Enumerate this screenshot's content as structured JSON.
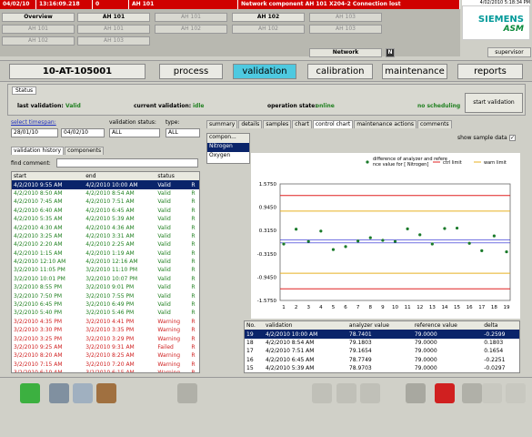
{
  "alarm": {
    "date": "04/02/10",
    "time": "13:16:09.218",
    "num": "0",
    "area": "AH 101",
    "message": "Network component AH 101 X204-2  Connection lost"
  },
  "grid": {
    "overview": "Overview",
    "ah101": "AH 101",
    "ah102": "AH 102",
    "network": "Network",
    "n_badge": "N",
    "dim1": "AH 101",
    "dim2": "AH 102",
    "dim3": "AH 103"
  },
  "logo": {
    "brand": "SIEMENS",
    "sub": "ASM",
    "datetime": "4/02/2010 5:18:34 PM"
  },
  "user": "supervisor",
  "tag": "10-AT-105001",
  "nav": [
    "process",
    "validation",
    "calibration",
    "maintenance",
    "reports"
  ],
  "status": {
    "tab": "Status",
    "last_label": "last validation:",
    "last_value": "Valid",
    "cur_label": "current validation:",
    "cur_value": "idle",
    "op_label": "operation state:",
    "op_value": "online",
    "sched": "no scheduling",
    "start_btn": "start validation"
  },
  "filters": {
    "timespan_label": "select timespan:",
    "from": "28/01/10",
    "to": "04/02/10",
    "vstatus_label": "validation status:",
    "vstatus": "ALL",
    "type_label": "type:",
    "type": "ALL"
  },
  "lefttabs": [
    "validation history",
    "components"
  ],
  "find_label": "find comment:",
  "hist_headers": [
    "start",
    "end",
    "status",
    ""
  ],
  "history": [
    {
      "s": "4/2/2010 9:55 AM",
      "e": "4/2/2010 10:00 AM",
      "st": "Valid",
      "t": "R",
      "c": "sel"
    },
    {
      "s": "4/2/2010 8:50 AM",
      "e": "4/2/2010 8:54 AM",
      "st": "Valid",
      "t": "R",
      "c": "green"
    },
    {
      "s": "4/2/2010 7:45 AM",
      "e": "4/2/2010 7:51 AM",
      "st": "Valid",
      "t": "R",
      "c": "green"
    },
    {
      "s": "4/2/2010 6:40 AM",
      "e": "4/2/2010 6:45 AM",
      "st": "Valid",
      "t": "R",
      "c": "green"
    },
    {
      "s": "4/2/2010 5:35 AM",
      "e": "4/2/2010 5:39 AM",
      "st": "Valid",
      "t": "R",
      "c": "green"
    },
    {
      "s": "4/2/2010 4:30 AM",
      "e": "4/2/2010 4:36 AM",
      "st": "Valid",
      "t": "R",
      "c": "green"
    },
    {
      "s": "4/2/2010 3:25 AM",
      "e": "4/2/2010 3:31 AM",
      "st": "Valid",
      "t": "R",
      "c": "green"
    },
    {
      "s": "4/2/2010 2:20 AM",
      "e": "4/2/2010 2:25 AM",
      "st": "Valid",
      "t": "R",
      "c": "green"
    },
    {
      "s": "4/2/2010 1:15 AM",
      "e": "4/2/2010 1:19 AM",
      "st": "Valid",
      "t": "R",
      "c": "green"
    },
    {
      "s": "4/2/2010 12:10 AM",
      "e": "4/2/2010 12:16 AM",
      "st": "Valid",
      "t": "R",
      "c": "green"
    },
    {
      "s": "3/2/2010 11:05 PM",
      "e": "3/2/2010 11:10 PM",
      "st": "Valid",
      "t": "R",
      "c": "green"
    },
    {
      "s": "3/2/2010 10:01 PM",
      "e": "3/2/2010 10:07 PM",
      "st": "Valid",
      "t": "R",
      "c": "green"
    },
    {
      "s": "3/2/2010 8:55 PM",
      "e": "3/2/2010 9:01 PM",
      "st": "Valid",
      "t": "R",
      "c": "green"
    },
    {
      "s": "3/2/2010 7:50 PM",
      "e": "3/2/2010 7:55 PM",
      "st": "Valid",
      "t": "R",
      "c": "green"
    },
    {
      "s": "3/2/2010 6:45 PM",
      "e": "3/2/2010 6:49 PM",
      "st": "Valid",
      "t": "R",
      "c": "green"
    },
    {
      "s": "3/2/2010 5:40 PM",
      "e": "3/2/2010 5:46 PM",
      "st": "Valid",
      "t": "R",
      "c": "green"
    },
    {
      "s": "3/2/2010 4:35 PM",
      "e": "3/2/2010 4:41 PM",
      "st": "Warning",
      "t": "R",
      "c": "red"
    },
    {
      "s": "3/2/2010 3:30 PM",
      "e": "3/2/2010 3:35 PM",
      "st": "Warning",
      "t": "R",
      "c": "red"
    },
    {
      "s": "3/2/2010 3:25 PM",
      "e": "3/2/2010 3:29 PM",
      "st": "Warning",
      "t": "R",
      "c": "red"
    },
    {
      "s": "3/2/2010 9:25 AM",
      "e": "3/2/2010 9:31 AM",
      "st": "Failed",
      "t": "R",
      "c": "red"
    },
    {
      "s": "3/2/2010 8:20 AM",
      "e": "3/2/2010 8:25 AM",
      "st": "Warning",
      "t": "R",
      "c": "red"
    },
    {
      "s": "3/2/2010 7:15 AM",
      "e": "3/2/2010 7:20 AM",
      "st": "Warning",
      "t": "R",
      "c": "red"
    },
    {
      "s": "3/2/2010 6:10 AM",
      "e": "3/2/2010 6:15 AM",
      "st": "Warning",
      "t": "R",
      "c": "red"
    }
  ],
  "righttabs": [
    "summary",
    "details",
    "samples",
    "chart",
    "control chart",
    "maintenance actions",
    "comments"
  ],
  "components_header": "compon...",
  "components": [
    "Nitrogen",
    "Oxygen"
  ],
  "show_sample": "show sample data",
  "table_headers": [
    "No.",
    "validation",
    "analyzer value",
    "reference value",
    "delta"
  ],
  "table_rows": [
    {
      "no": "19",
      "v": "4/2/2010 10:00 AM",
      "a": "78.7401",
      "r": "79.0000",
      "d": "-0.2599"
    },
    {
      "no": "18",
      "v": "4/2/2010 8:54 AM",
      "a": "79.1803",
      "r": "79.0000",
      "d": "0.1803"
    },
    {
      "no": "17",
      "v": "4/2/2010 7:51 AM",
      "a": "79.1654",
      "r": "79.0000",
      "d": "0.1654"
    },
    {
      "no": "16",
      "v": "4/2/2010 6:45 AM",
      "a": "78.7749",
      "r": "79.0000",
      "d": "-0.2251"
    },
    {
      "no": "15",
      "v": "4/2/2010 5:39 AM",
      "a": "78.9703",
      "r": "79.0000",
      "d": "-0.0297"
    },
    {
      "no": "14",
      "v": "4/2/2010 4:36 AM",
      "a": "79.3805",
      "r": "79.0000",
      "d": "0.3805"
    },
    {
      "no": "13",
      "v": "4/2/2010 3:31 AM",
      "a": "79.3780",
      "r": "79.0000",
      "d": "0.3780"
    }
  ],
  "chart_data": {
    "type": "scatter",
    "legend": [
      "difference of analyzer and reference value for [ Nitrogen]",
      "ctrl limit",
      "warn limit"
    ],
    "yticks": [
      "1.5750",
      "0.9450",
      "0.3150",
      "-0.3150",
      "-0.9450",
      "-1.5750"
    ],
    "ylim": [
      -1.575,
      1.575
    ],
    "x": [
      1,
      2,
      3,
      4,
      5,
      6,
      7,
      8,
      9,
      10,
      11,
      12,
      13,
      14,
      15,
      16,
      17,
      18,
      19
    ],
    "y": [
      -0.05,
      0.35,
      0.02,
      0.3,
      -0.2,
      -0.12,
      0.03,
      0.12,
      0.05,
      0.02,
      0.36,
      0.2,
      -0.05,
      0.37,
      0.38,
      -0.03,
      -0.23,
      0.17,
      -0.26
    ],
    "ctrl_limits": [
      1.26,
      -1.26
    ],
    "warn_limits": [
      0.84,
      -0.84
    ],
    "center_lines": [
      0.06,
      -0.02
    ],
    "colors": {
      "points": "#1a7a2a",
      "ctrl": "#e02020",
      "warn": "#e8b020",
      "center": "#2020d0"
    }
  }
}
